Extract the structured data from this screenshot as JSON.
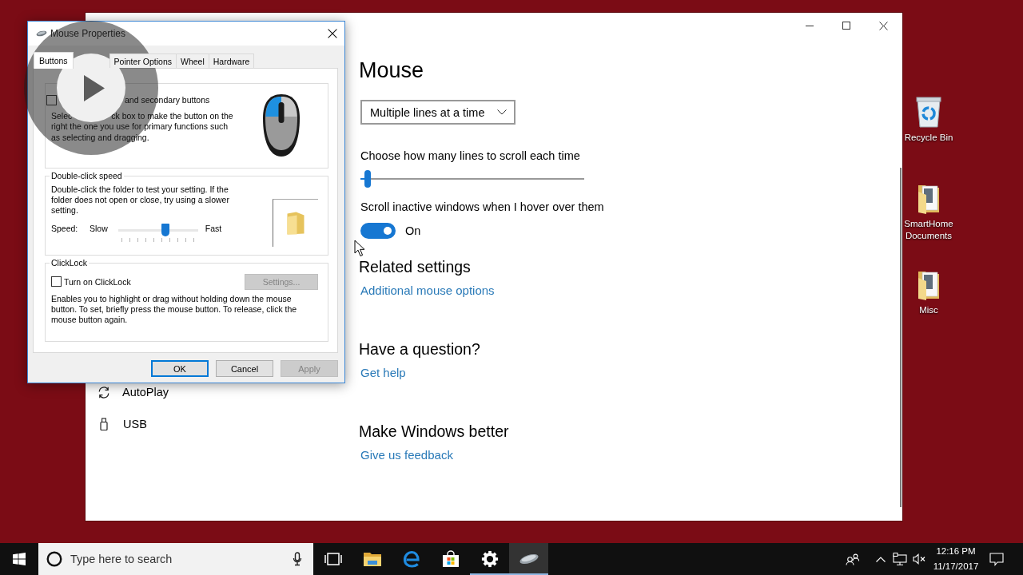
{
  "desktop": {
    "icons": [
      {
        "label": "Recycle Bin",
        "kind": "recycle-bin"
      },
      {
        "label": "SmartHome Documents",
        "kind": "folder"
      },
      {
        "label": "Misc",
        "kind": "folder"
      }
    ]
  },
  "settings_window": {
    "sidebar": {
      "items": [
        {
          "label": "AutoPlay",
          "kind": "autoplay"
        },
        {
          "label": "USB",
          "kind": "usb"
        }
      ]
    },
    "page": {
      "title": "Mouse",
      "wheel_dropdown": {
        "value": "Multiple lines at a time"
      },
      "lines_slider": {
        "label": "Choose how many lines to scroll each time",
        "level": 0.02
      },
      "inactive_scroll": {
        "label": "Scroll inactive windows when I hover over them",
        "on": true,
        "state_text": "On"
      },
      "sections": [
        {
          "heading": "Related settings",
          "link": "Additional mouse options"
        },
        {
          "heading": "Have a question?",
          "link": "Get help"
        },
        {
          "heading": "Make Windows better",
          "link": "Give us feedback"
        }
      ]
    }
  },
  "mouse_properties": {
    "title": "Mouse Properties",
    "tabs": [
      {
        "label": "Buttons",
        "selected": true
      },
      {
        "label": "Pointer Options",
        "selected": false
      },
      {
        "label": "Wheel",
        "selected": false
      },
      {
        "label": "Hardware",
        "selected": false
      }
    ],
    "button_configuration": {
      "checkbox": {
        "label": "and secondary buttons",
        "checked": false
      },
      "description_lines": [
        {
          "parts": [
            "Selec",
            "ck box to make the button on the"
          ]
        },
        {
          "parts": [
            "right the one you use for primary functions such"
          ]
        },
        {
          "parts": [
            "as selecting and dragging."
          ]
        }
      ]
    },
    "double_click_speed": {
      "title": "Double-click speed",
      "description": "Double-click the folder to test your setting. If the folder does not open or close, try using a slower setting.",
      "speed_label": "Speed:",
      "slow_label": "Slow",
      "fast_label": "Fast",
      "level": 0.6
    },
    "click_lock": {
      "title": "ClickLock",
      "checkbox": {
        "label": "Turn on ClickLock",
        "checked": false
      },
      "settings_button": {
        "label": "Settings...",
        "disabled": true
      },
      "description": "Enables you to highlight or drag without holding down the mouse button. To set, briefly press the mouse button. To release, click the mouse button again."
    },
    "buttons": [
      {
        "label": "OK",
        "default": true,
        "disabled": false
      },
      {
        "label": "Cancel",
        "default": false,
        "disabled": false
      },
      {
        "label": "Apply",
        "default": false,
        "disabled": true
      }
    ]
  },
  "taskbar": {
    "search": {
      "placeholder": "Type here to search"
    },
    "apps": [
      {
        "kind": "task-view",
        "running": false,
        "selected": false
      },
      {
        "kind": "file-explorer",
        "running": false,
        "selected": false
      },
      {
        "kind": "browser",
        "running": false,
        "selected": false
      },
      {
        "kind": "store",
        "running": false,
        "selected": false
      },
      {
        "kind": "settings",
        "running": true,
        "selected": false
      },
      {
        "kind": "mouse",
        "running": true,
        "selected": true
      }
    ],
    "clock": {
      "time": "12:16 PM",
      "date": "11/17/2017"
    }
  }
}
